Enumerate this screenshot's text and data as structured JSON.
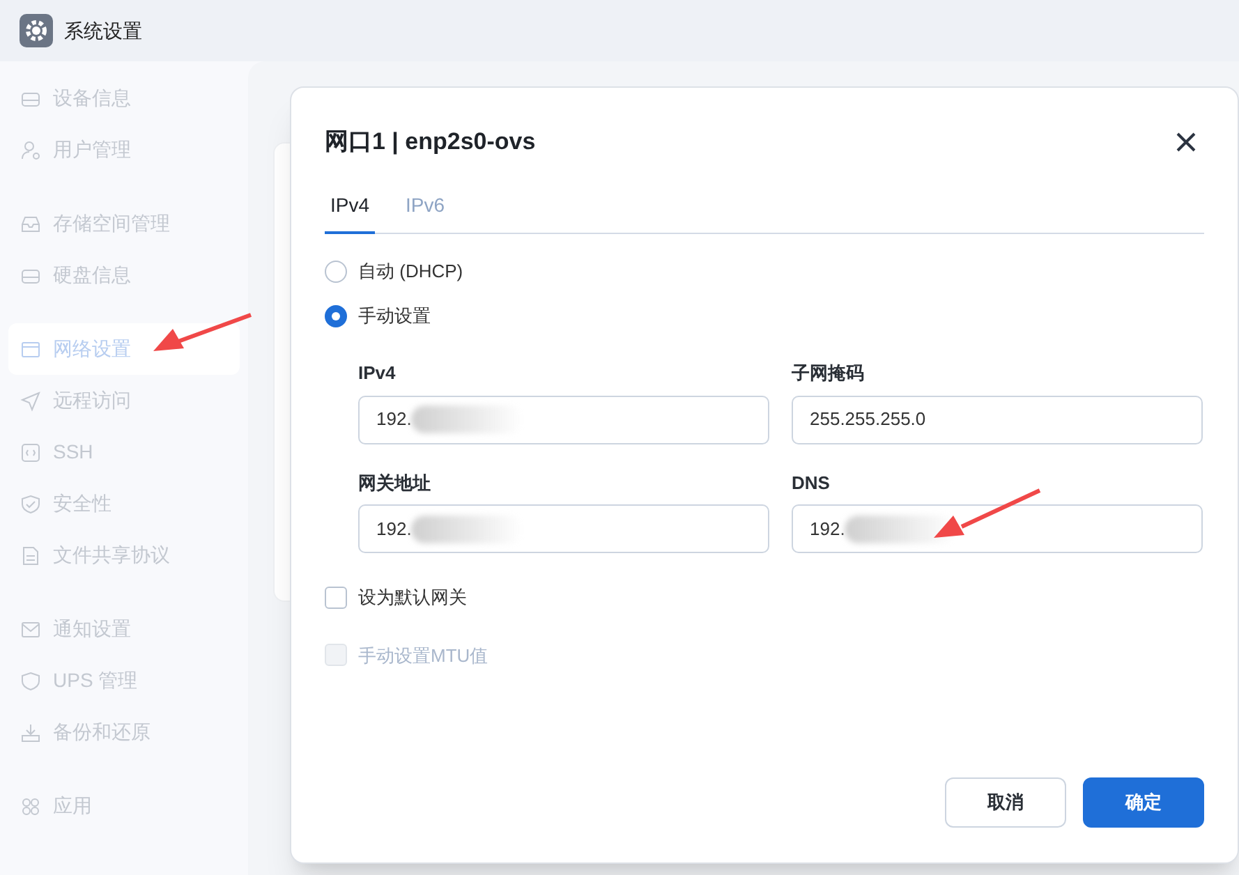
{
  "window": {
    "title": "系统设置"
  },
  "sidebar": {
    "groups": [
      {
        "items": [
          {
            "label": "设备信息",
            "selected": false
          },
          {
            "label": "用户管理",
            "selected": false
          }
        ]
      },
      {
        "items": [
          {
            "label": "存储空间管理",
            "selected": false
          },
          {
            "label": "硬盘信息",
            "selected": false
          }
        ]
      },
      {
        "items": [
          {
            "label": "网络设置",
            "selected": true
          },
          {
            "label": "远程访问",
            "selected": false
          },
          {
            "label": "SSH",
            "selected": false
          },
          {
            "label": "安全性",
            "selected": false
          },
          {
            "label": "文件共享协议",
            "selected": false
          }
        ]
      },
      {
        "items": [
          {
            "label": "通知设置",
            "selected": false
          },
          {
            "label": "UPS 管理",
            "selected": false
          },
          {
            "label": "备份和还原",
            "selected": false
          }
        ]
      },
      {
        "items": [
          {
            "label": "应用",
            "selected": false
          }
        ]
      }
    ]
  },
  "dialog": {
    "title": "网口1 | enp2s0-ovs",
    "tabs": [
      {
        "label": "IPv4",
        "selected": true
      },
      {
        "label": "IPv6",
        "selected": false
      }
    ],
    "modes": [
      {
        "label": "自动 (DHCP)",
        "selected": false
      },
      {
        "label": "手动设置",
        "selected": true
      }
    ],
    "fields": [
      {
        "label": "IPv4",
        "value": "192.",
        "redacted": true
      },
      {
        "label": "子网掩码",
        "value": "255.255.255.0",
        "redacted": false
      },
      {
        "label": "网关地址",
        "value": "192.",
        "redacted": true
      },
      {
        "label": "DNS",
        "value": "192.",
        "redacted": true
      }
    ],
    "options": [
      {
        "label": "设为默认网关",
        "checked": false,
        "disabled": false
      },
      {
        "label": "手动设置MTU值",
        "checked": false,
        "disabled": true
      }
    ],
    "buttons": [
      {
        "label": "取消",
        "kind": "secondary"
      },
      {
        "label": "确定",
        "kind": "primary"
      }
    ]
  }
}
